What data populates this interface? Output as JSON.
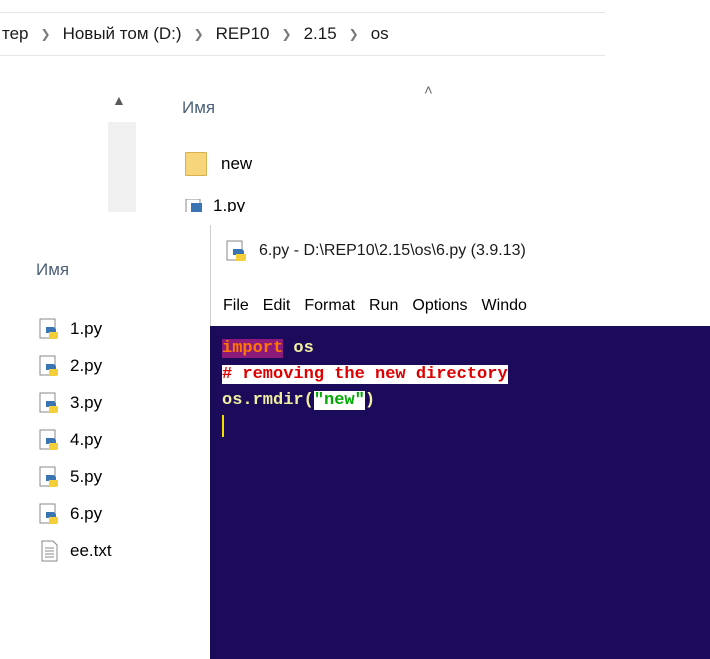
{
  "top_explorer": {
    "breadcrumb": [
      "тер",
      "Новый том (D:)",
      "REP10",
      "2.15",
      "os"
    ],
    "column_header": "Имя",
    "items": [
      {
        "name": "new",
        "icon": "folder-icon"
      },
      {
        "name": "1.py",
        "icon": "python-file-icon"
      }
    ]
  },
  "left_explorer": {
    "column_header": "Имя",
    "files": [
      {
        "name": "1.py",
        "icon": "python-file-icon"
      },
      {
        "name": "2.py",
        "icon": "python-file-icon"
      },
      {
        "name": "3.py",
        "icon": "python-file-icon"
      },
      {
        "name": "4.py",
        "icon": "python-file-icon"
      },
      {
        "name": "5.py",
        "icon": "python-file-icon"
      },
      {
        "name": "6.py",
        "icon": "python-file-icon"
      },
      {
        "name": "ee.txt",
        "icon": "text-file-icon"
      }
    ]
  },
  "idle": {
    "title": "6.py - D:\\REP10\\2.15\\os\\6.py (3.9.13)",
    "menu": [
      "File",
      "Edit",
      "Format",
      "Run",
      "Options",
      "Windo"
    ],
    "code": {
      "line1_keyword": "import",
      "line1_rest": " os",
      "line2_comment": "# removing the new directory",
      "line3_call": "os.rmdir(",
      "line3_string": "\"new\"",
      "line3_close": ")"
    },
    "colors": {
      "editor_bg": "#1c0a5b",
      "keyword": "#ff7700",
      "comment": "#dd0000",
      "string": "#00aa00",
      "cursor": "#f0e000"
    }
  }
}
